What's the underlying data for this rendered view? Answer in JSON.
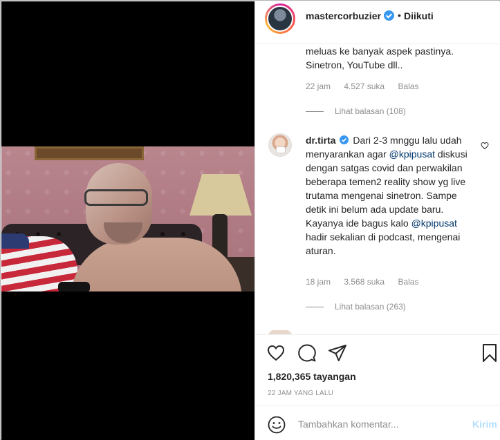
{
  "post": {
    "username": "mastercorbuzier",
    "follow_status": "Diikuti",
    "dot": "•"
  },
  "comments": [
    {
      "text": "meluas ke banyak aspek pastinya. Sinetron, YouTube dll..",
      "time": "22 jam",
      "likes": "4.527 suka",
      "reply_label": "Balas",
      "view_replies": "Lihat balasan (108)"
    },
    {
      "username": "dr.tirta",
      "text_1": "Dari 2-3 mnggu lalu udah menyarankan agar ",
      "mention_1": "@kpipusat",
      "text_2": " diskusi dengan satgas covid dan perwakilan beberapa temen2 reality show yg live trutama mengenai sinetron. Sampe detik ini belum ada update baru. Kayanya ide bagus kalo ",
      "mention_2": "@kpipusat",
      "text_3": " hadir sekalian di podcast, mengenai aturan.",
      "time": "18 jam",
      "likes": "3.568 suka",
      "reply_label": "Balas",
      "view_replies": "Lihat balasan (263)"
    }
  ],
  "actions": {
    "views": "1,820,365 tayangan",
    "time_ago": "22 JAM YANG LALU"
  },
  "comment_box": {
    "placeholder": "Tambahkan komentar...",
    "post_label": "Kirim"
  },
  "icons": {
    "like": "heart-icon",
    "comment": "comment-bubble-icon",
    "share": "paper-plane-icon",
    "save": "bookmark-icon",
    "emoji": "emoji-icon",
    "verified": "verified-badge-icon"
  },
  "colors": {
    "verified": "#3897f0",
    "mention": "#00376b",
    "muted": "#8e8e8e",
    "post_button_disabled": "#b2dffc"
  }
}
